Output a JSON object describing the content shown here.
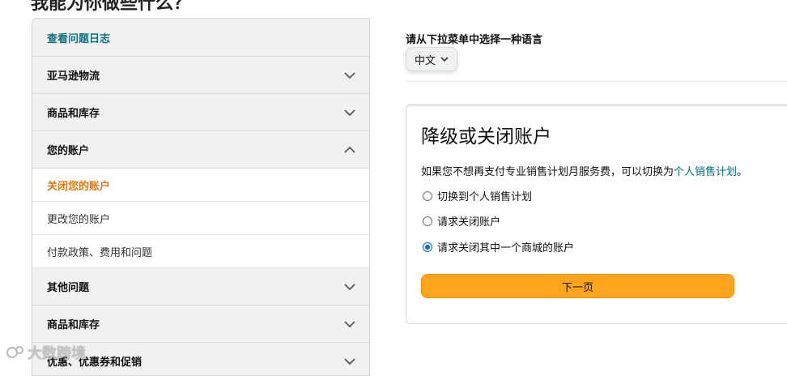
{
  "page": {
    "heading": "我能为你做些什么？"
  },
  "sidebar": {
    "items": [
      {
        "label": "查看问题日志",
        "type": "link"
      },
      {
        "label": "亚马逊物流",
        "type": "collapsed"
      },
      {
        "label": "商品和库存",
        "type": "collapsed"
      },
      {
        "label": "您的账户",
        "type": "expanded"
      },
      {
        "label": "关闭您的账户",
        "type": "sub-active"
      },
      {
        "label": "更改您的账户",
        "type": "sub"
      },
      {
        "label": "付款政策、费用和问题",
        "type": "sub"
      },
      {
        "label": "其他问题",
        "type": "collapsed"
      },
      {
        "label": "商品和库存",
        "type": "collapsed"
      },
      {
        "label": "优惠、优惠券和促销",
        "type": "collapsed"
      }
    ]
  },
  "language": {
    "label": "请从下拉菜单中选择一种语言",
    "selected": "中文"
  },
  "card": {
    "title": "降级或关闭账户",
    "desc_prefix": "如果您不想再支付专业销售计划月服务费，可以切换为",
    "desc_link": "个人销售计划",
    "desc_suffix": "。",
    "options": [
      {
        "label": "切换到个人销售计划",
        "checked": false
      },
      {
        "label": "请求关闭账户",
        "checked": false
      },
      {
        "label": "请求关闭其中一个商城的账户",
        "checked": true
      }
    ],
    "next_label": "下一页"
  },
  "watermark": {
    "text": "大数跨境"
  },
  "colors": {
    "accent_orange": "#e47911",
    "button": "#ffa41c",
    "link": "#007185"
  }
}
